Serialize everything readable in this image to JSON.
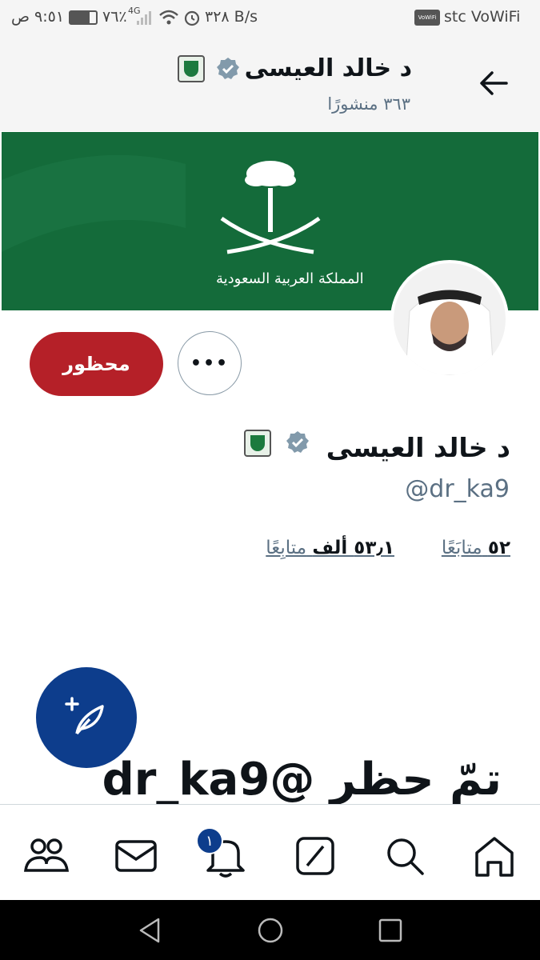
{
  "status_bar": {
    "time": "٩:٥١ ص",
    "battery": "٧٦٪",
    "network": "4G",
    "speed": "٣٢٨ B/s",
    "carrier": "stc VoWiFi",
    "vowifi_badge": "VoWiFi"
  },
  "header": {
    "name": "د خالد العيسى",
    "posts_count": "٣٦٣ منشورًا"
  },
  "banner": {
    "caption": "المملكة العربية السعودية",
    "brand_color": "#146b3a"
  },
  "actions": {
    "blocked_label": "محظور",
    "more_label": "•••"
  },
  "profile": {
    "name": "د خالد العيسى",
    "handle": "@dr_ka9",
    "following_count": "٥٢",
    "following_label": "متابَعًا",
    "followers_count": "٥٣٫١ ألف",
    "followers_label": "متابِعًا"
  },
  "blocked_notice": "تمّ حظر @dr_ka9",
  "bottom_nav": {
    "notification_count": "١",
    "items": [
      "communities-icon",
      "messages-icon",
      "notifications-icon",
      "grok-icon",
      "search-icon",
      "home-icon"
    ]
  },
  "colors": {
    "accent": "#0d3d8c",
    "blocked": "#b52028",
    "verified": "#829aab"
  }
}
